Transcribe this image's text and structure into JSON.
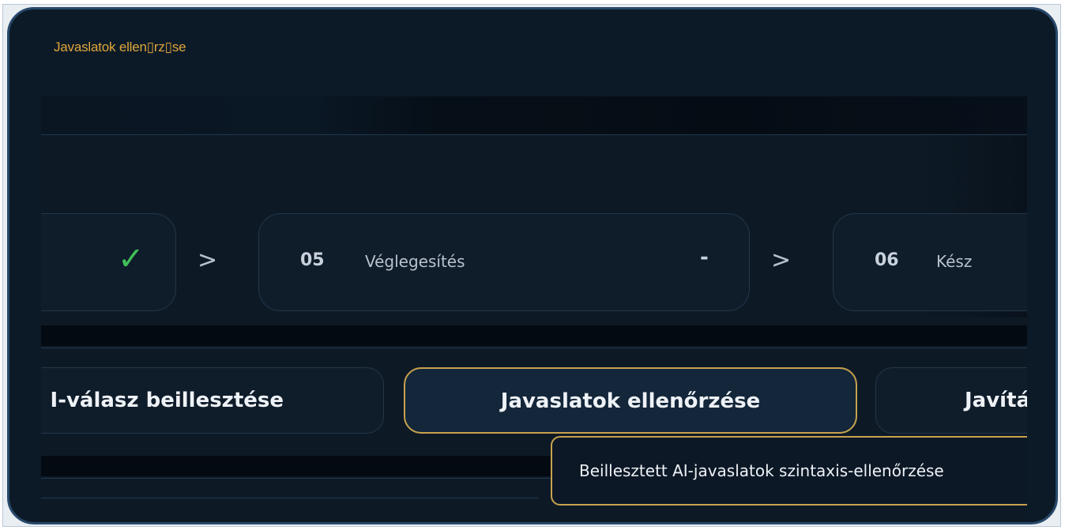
{
  "window": {
    "title": "Javaslatok ellen\u0000rz\u0000se"
  },
  "steps": [
    {
      "status_icon": "check-icon",
      "status": "✓"
    },
    {
      "num": "05",
      "label": "Véglegesítés",
      "status": "-"
    },
    {
      "num": "06",
      "label": "Kész"
    }
  ],
  "separator": ">",
  "actions": [
    {
      "label": "AI-válasz beillesztése",
      "visible_text": "I-válasz beillesztése"
    },
    {
      "label": "Javaslatok ellenőrzése",
      "active": true
    },
    {
      "label": "Javítá"
    }
  ],
  "tooltip": {
    "text": "Beillesztett AI-javaslatok szintaxis-ellenőrzése"
  },
  "colors": {
    "accent": "#c8a24e",
    "title": "#e0a63a",
    "success": "#3fbf58",
    "background": "#0c1a28"
  }
}
